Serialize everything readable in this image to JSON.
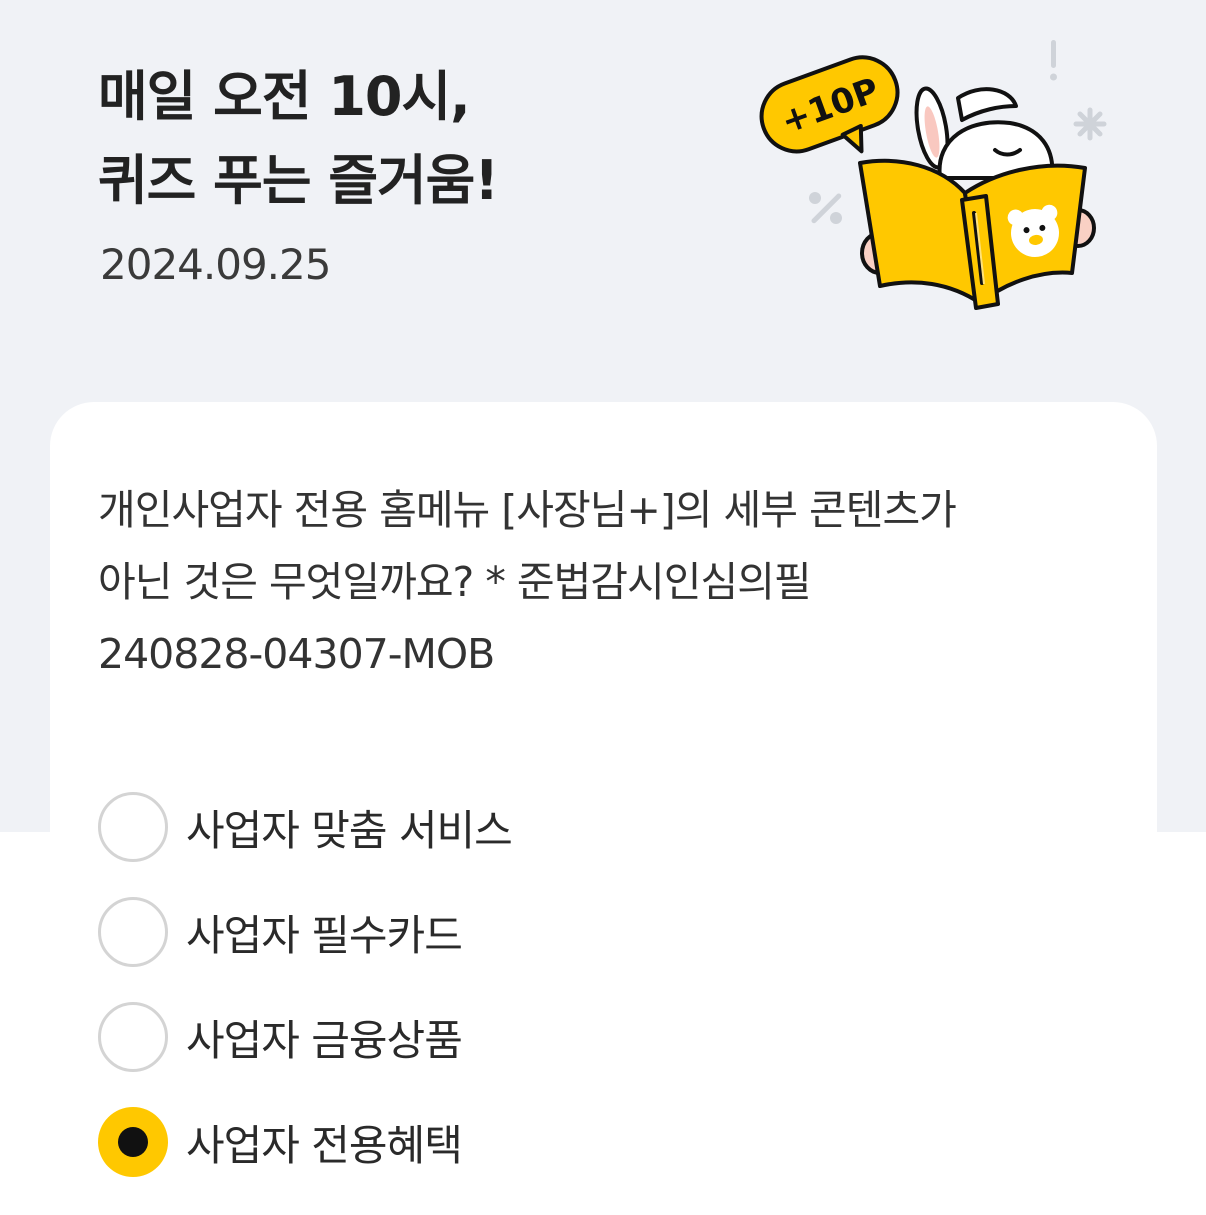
{
  "header": {
    "title_line1": "매일 오전 10시,",
    "title_line2": "퀴즈 푸는 즐거움!",
    "date": "2024.09.25",
    "badge_text": "+10P"
  },
  "quiz": {
    "question_line1": "개인사업자 전용 홈메뉴 [사장님+]의 세부 콘텐츠가",
    "question_line2": "아닌 것은 무엇일까요? * 준법감시인심의필",
    "question_line3": "240828-04307-MOB",
    "options": [
      {
        "label": "사업자 맞춤 서비스",
        "selected": false
      },
      {
        "label": "사업자 필수카드",
        "selected": false
      },
      {
        "label": "사업자 금융상품",
        "selected": false
      },
      {
        "label": "사업자 전용혜택",
        "selected": true
      }
    ]
  },
  "colors": {
    "background_top": "#f0f2f6",
    "card": "#ffffff",
    "accent_yellow": "#ffc800",
    "radio_border": "#d4d4d4"
  },
  "icons": {
    "illustration": "rabbit-reading-book-illustration",
    "bear_logo": "bear-face-icon"
  }
}
